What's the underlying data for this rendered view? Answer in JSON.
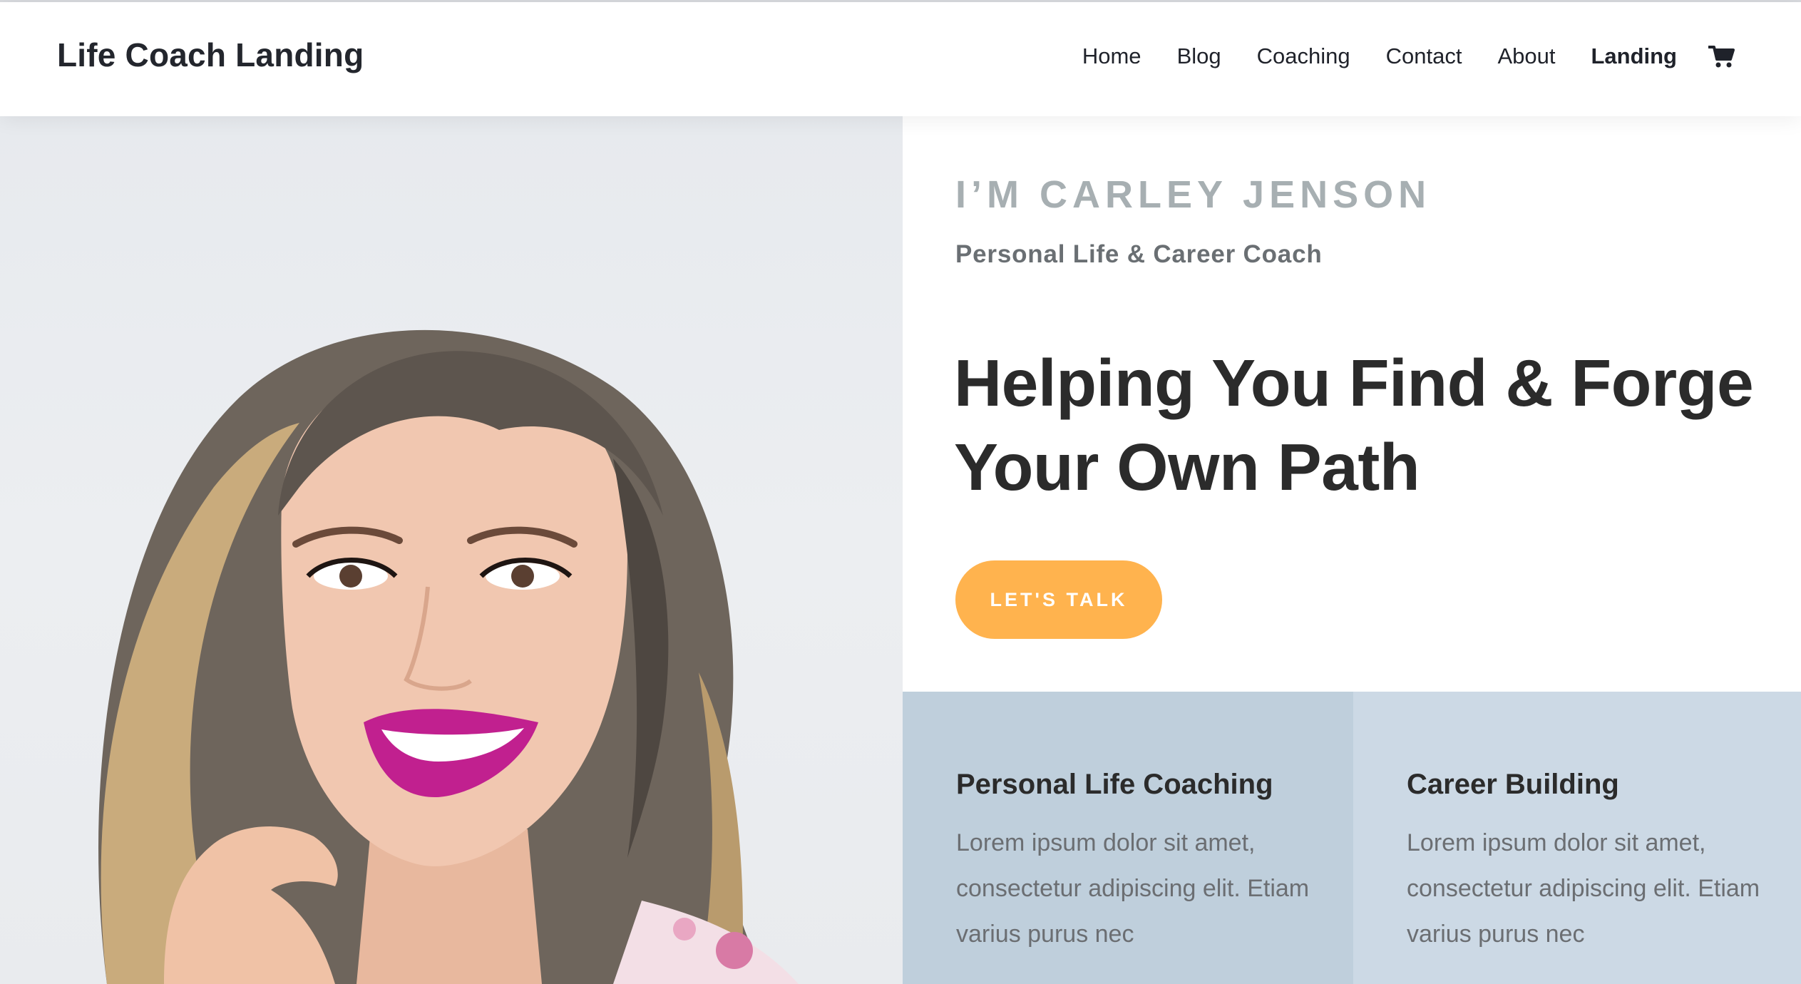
{
  "site": {
    "logo": "Life Coach Landing"
  },
  "nav": {
    "items": [
      {
        "label": "Home"
      },
      {
        "label": "Blog"
      },
      {
        "label": "Coaching"
      },
      {
        "label": "Contact"
      },
      {
        "label": "About"
      },
      {
        "label": "Landing"
      }
    ],
    "cart_icon": "shopping-cart-icon"
  },
  "hero": {
    "eyebrow": "I’M CARLEY JENSON",
    "subtitle": "Personal Life & Career Coach",
    "headline_line1": "Helping You Find & Forge",
    "headline_line2": "Your Own Path",
    "cta_label": "LET'S TALK"
  },
  "cards": [
    {
      "title": "Personal Life Coaching",
      "text": "Lorem ipsum dolor sit amet, consectetur adipiscing elit. Etiam varius purus nec"
    },
    {
      "title": "Career Building",
      "text": "Lorem ipsum dolor sit amet, consectetur adipiscing elit. Etiam varius purus nec"
    }
  ],
  "colors": {
    "cta": "#ffb34e",
    "eyebrow": "#a7afb2",
    "card_1_bg": "#bfcfdc",
    "card_2_bg": "#ccd9e5",
    "text_dark": "#2b2b2b"
  }
}
